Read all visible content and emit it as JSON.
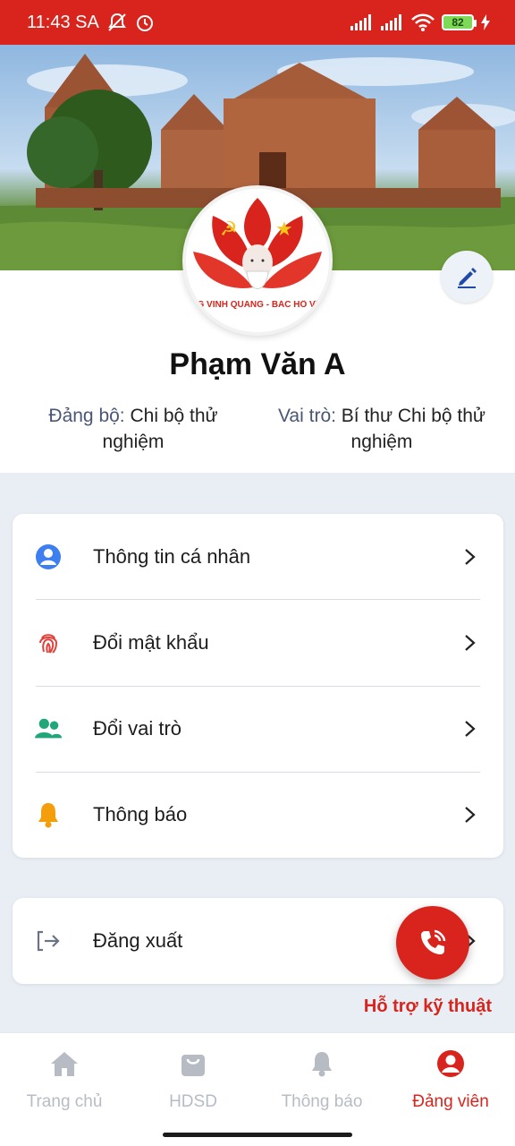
{
  "status_bar": {
    "time": "11:43 SA",
    "battery": "82"
  },
  "profile": {
    "name": "Phạm Văn A",
    "unit_key": "Đảng bộ:",
    "unit_value": "Chi bộ thử nghiệm",
    "role_key": "Vai trò:",
    "role_value": "Bí thư Chi bộ thử nghiệm",
    "avatar_text": "G VINH QUANG - BÁC HỒ VĨ"
  },
  "menu": {
    "items": [
      {
        "label": "Thông tin cá nhân",
        "icon": "user-icon"
      },
      {
        "label": "Đổi mật khẩu",
        "icon": "fingerprint-icon"
      },
      {
        "label": "Đổi vai trò",
        "icon": "users-icon"
      },
      {
        "label": "Thông báo",
        "icon": "bell-icon"
      }
    ],
    "logout": {
      "label": "Đăng xuất",
      "icon": "logout-icon"
    }
  },
  "support": {
    "label": "Hỗ trợ kỹ thuật",
    "icon": "phone-icon"
  },
  "bottom_nav": {
    "items": [
      {
        "label": "Trang chủ",
        "icon": "home-icon",
        "active": false
      },
      {
        "label": "HDSD",
        "icon": "bag-icon",
        "active": false
      },
      {
        "label": "Thông báo",
        "icon": "bell-icon",
        "active": false
      },
      {
        "label": "Đảng viên",
        "icon": "user-circle-icon",
        "active": true
      }
    ]
  },
  "colors": {
    "primary": "#d8241c",
    "background": "#e9eef5",
    "inactive": "#b7bcc4"
  }
}
